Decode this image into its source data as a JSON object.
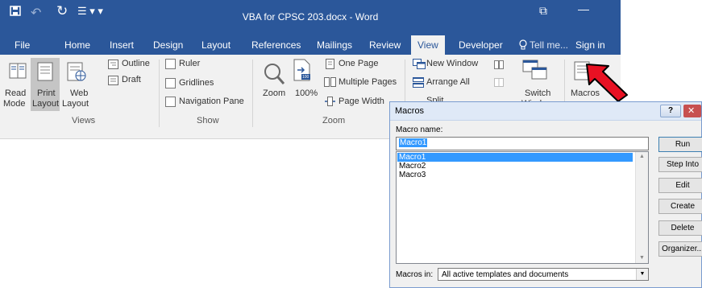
{
  "window": {
    "title": "VBA for CPSC 203.docx - Word",
    "minimize_glyph": "—",
    "restore_glyph": "⧉"
  },
  "qat": {
    "undo_glyph": "↶",
    "redo_glyph": "↻",
    "customize_glyph": "☰ ▾ ▾"
  },
  "tabs": [
    "File",
    "Home",
    "Insert",
    "Design",
    "Layout",
    "References",
    "Mailings",
    "Review",
    "View",
    "Developer",
    "Tell me...",
    "Sign in"
  ],
  "ribbon": {
    "views": {
      "read_mode": [
        "Read",
        "Mode"
      ],
      "print_layout": [
        "Print",
        "Layout"
      ],
      "web_layout": [
        "Web",
        "Layout"
      ],
      "outline": "Outline",
      "draft": "Draft",
      "group_label": "Views"
    },
    "show": {
      "ruler": "Ruler",
      "gridlines": "Gridlines",
      "navigation_pane": "Navigation Pane",
      "group_label": "Show"
    },
    "zoom": {
      "zoom": "Zoom",
      "hundred": "100%",
      "hundred_icon": "100",
      "one_page": "One Page",
      "multiple_pages": "Multiple Pages",
      "page_width": "Page Width",
      "group_label": "Zoom"
    },
    "window_group": {
      "new_window": "New Window",
      "arrange_all": "Arrange All",
      "split": "Split",
      "switch": [
        "Switch",
        "Windows"
      ]
    },
    "macros": {
      "label": "Macros"
    }
  },
  "dialog": {
    "title": "Macros",
    "help_glyph": "?",
    "close_glyph": "✕",
    "macro_name_label": "Macro name:",
    "macro_name_value": "Macro1",
    "macros": [
      "Macro1",
      "Macro2",
      "Macro3"
    ],
    "selected_index": 0,
    "buttons": {
      "run": "Run",
      "step_into": "Step Into",
      "edit": "Edit",
      "create": "Create",
      "delete": "Delete",
      "organizer": "Organizer..."
    },
    "macros_in_label": "Macros in:",
    "macros_in_value": "All active templates and documents"
  },
  "colors": {
    "word_blue": "#2b579a",
    "ribbon_bg": "#f1f1f1",
    "selection": "#3399ff",
    "arrow_red": "#e81123"
  }
}
